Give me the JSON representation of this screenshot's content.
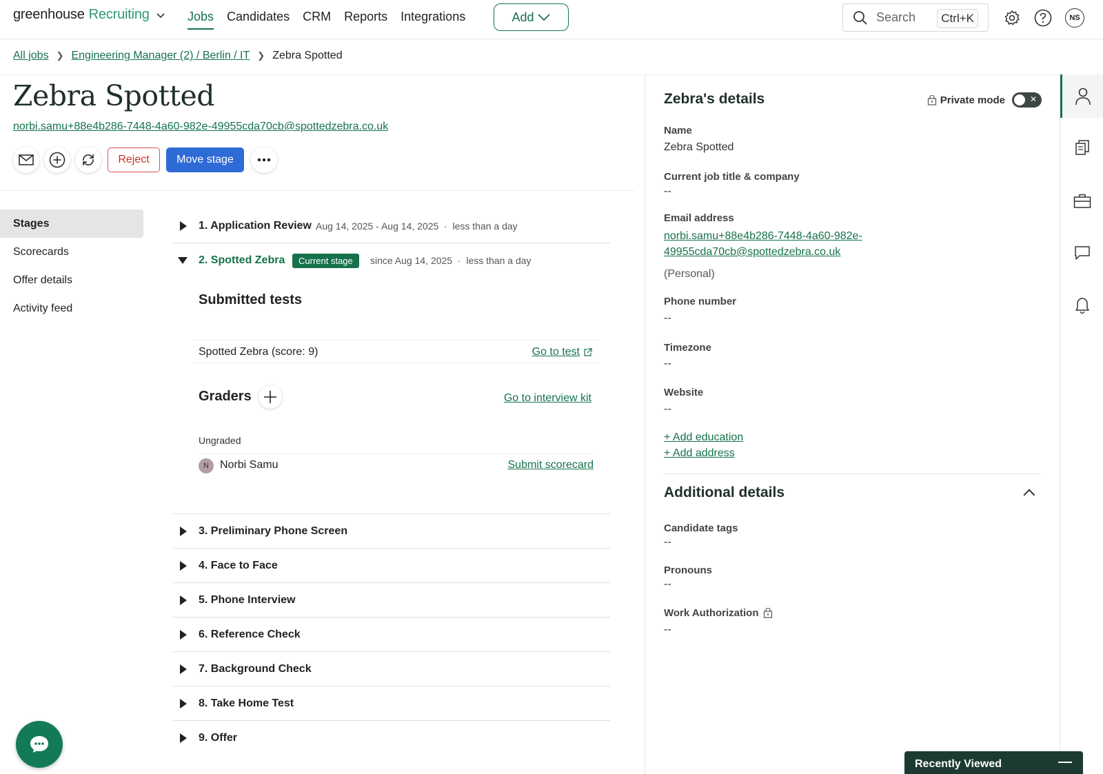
{
  "app": {
    "brand": "greenhouse",
    "product": "Recruiting"
  },
  "nav": {
    "links": [
      "Jobs",
      "Candidates",
      "CRM",
      "Reports",
      "Integrations"
    ],
    "active": "Jobs",
    "add_label": "Add",
    "search_placeholder": "Search",
    "search_shortcut": "Ctrl+K",
    "user_initials": "NS"
  },
  "breadcrumb": {
    "all_jobs": "All jobs",
    "job": "Engineering Manager (2) / Berlin / IT",
    "current": "Zebra Spotted"
  },
  "candidate": {
    "name": "Zebra Spotted",
    "email": "norbi.samu+88e4b286-7448-4a60-982e-49955cda70cb@spottedzebra.co.uk",
    "reject_label": "Reject",
    "move_stage_label": "Move stage"
  },
  "subnav": {
    "items": [
      "Stages",
      "Scorecards",
      "Offer details",
      "Activity feed"
    ],
    "active": "Stages"
  },
  "stages": {
    "stage1": {
      "title": "1. Application Review",
      "dates": "Aug 14, 2025 - Aug 14, 2025",
      "duration": "less than a day"
    },
    "stage2": {
      "title": "2. Spotted Zebra",
      "badge": "Current stage",
      "since": "since Aug 14, 2025",
      "duration": "less than a day",
      "submitted_tests_heading": "Submitted tests",
      "test_name": "Spotted Zebra (score: 9)",
      "go_to_test": "Go to test",
      "graders_heading": "Graders",
      "go_to_interview_kit": "Go to interview kit",
      "ungraded_label": "Ungraded",
      "grader_initial": "N",
      "grader_name": "Norbi Samu",
      "submit_scorecard": "Submit scorecard"
    },
    "collapsed": [
      "3. Preliminary Phone Screen",
      "4. Face to Face",
      "5. Phone Interview",
      "6. Reference Check",
      "7. Background Check",
      "8. Take Home Test",
      "9. Offer"
    ]
  },
  "details": {
    "title": "Zebra's details",
    "private_mode_label": "Private mode",
    "private_mode_on": false,
    "name_label": "Name",
    "name_value": "Zebra Spotted",
    "job_label": "Current job title & company",
    "job_value": "--",
    "email_label": "Email address",
    "email_line1": "norbi.samu+88e4b286-7448-4a60-982e-",
    "email_line2": "49955cda70cb@spottedzebra.co.uk",
    "email_type": "(Personal)",
    "phone_label": "Phone number",
    "phone_value": "--",
    "timezone_label": "Timezone",
    "timezone_value": "--",
    "website_label": "Website",
    "website_value": "--",
    "add_education": "+ Add education",
    "add_address": "+ Add address",
    "additional_title": "Additional details",
    "tags_label": "Candidate tags",
    "tags_value": "--",
    "pronouns_label": "Pronouns",
    "pronouns_value": "--",
    "work_auth_label": "Work Authorization",
    "work_auth_value": "--"
  },
  "rail": {
    "icons": [
      "person-icon",
      "documents-icon",
      "briefcase-icon",
      "comment-icon",
      "bell-icon"
    ],
    "active": "person-icon"
  },
  "recently_viewed": "Recently Viewed",
  "colors": {
    "brand_green": "#15724b",
    "primary_blue": "#2e6bd6",
    "reject_red": "#c9302c",
    "dark_green": "#1c3a31"
  }
}
